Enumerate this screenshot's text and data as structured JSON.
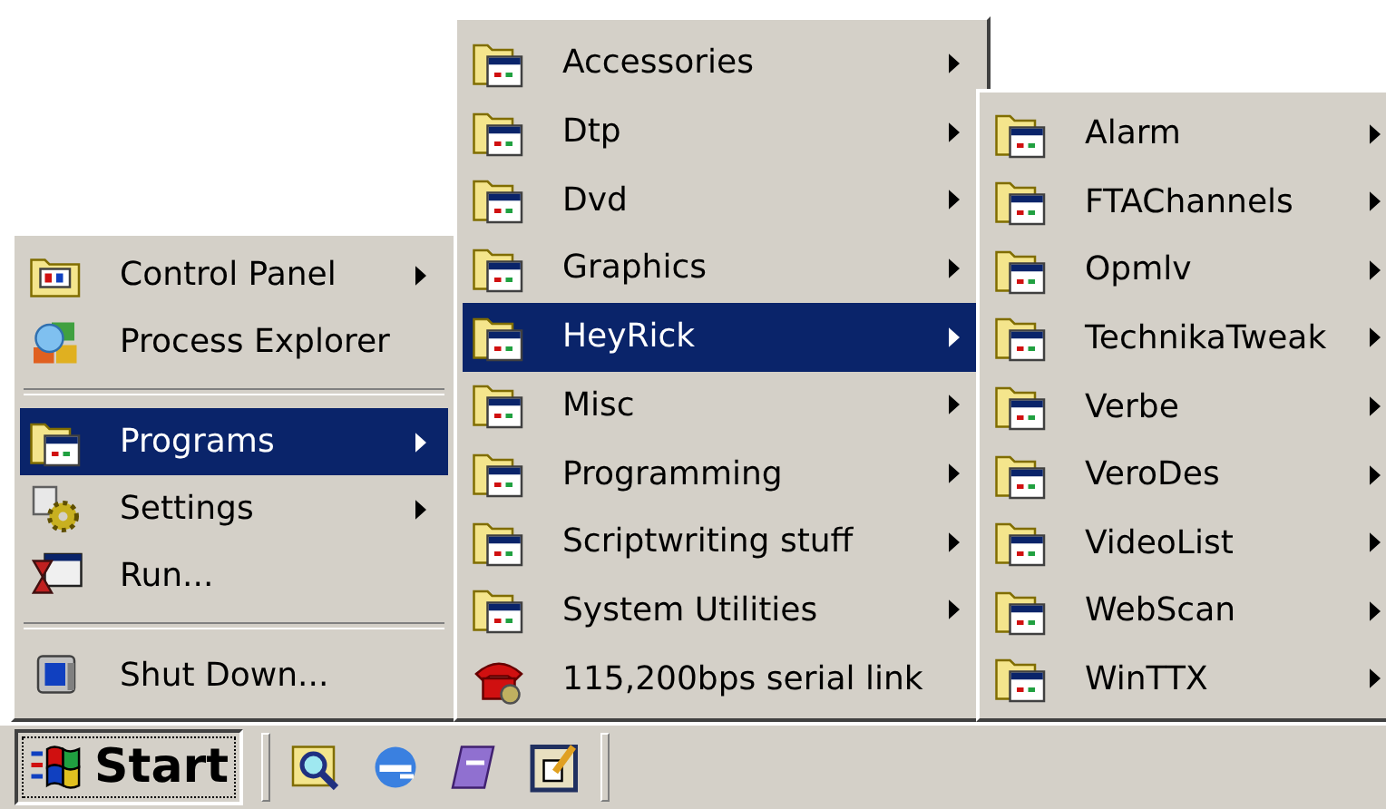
{
  "start_menu": {
    "items": [
      {
        "kind": "item",
        "label": "Control Panel",
        "submenu": true,
        "selected": false
      },
      {
        "kind": "item",
        "label": "Process Explorer",
        "submenu": false,
        "selected": false
      },
      {
        "kind": "separator"
      },
      {
        "kind": "item",
        "label": "Programs",
        "submenu": true,
        "selected": true
      },
      {
        "kind": "item",
        "label": "Settings",
        "submenu": true,
        "selected": false
      },
      {
        "kind": "item",
        "label": "Run...",
        "submenu": false,
        "selected": false
      },
      {
        "kind": "separator"
      },
      {
        "kind": "item",
        "label": "Shut Down...",
        "submenu": false,
        "selected": false
      }
    ]
  },
  "programs_menu": {
    "items": [
      {
        "kind": "folder",
        "label": "Accessories",
        "selected": false
      },
      {
        "kind": "folder",
        "label": "Dtp",
        "selected": false
      },
      {
        "kind": "folder",
        "label": "Dvd",
        "selected": false
      },
      {
        "kind": "folder",
        "label": "Graphics",
        "selected": false
      },
      {
        "kind": "folder",
        "label": "HeyRick",
        "selected": true
      },
      {
        "kind": "folder",
        "label": "Misc",
        "selected": false
      },
      {
        "kind": "folder",
        "label": "Programming",
        "selected": false
      },
      {
        "kind": "folder",
        "label": "Scriptwriting stuff",
        "selected": false
      },
      {
        "kind": "folder",
        "label": "System Utilities",
        "selected": false
      },
      {
        "kind": "shortcut",
        "label": "115,200bps serial link",
        "selected": false
      }
    ]
  },
  "heyrick_menu": {
    "items": [
      {
        "kind": "folder",
        "label": "Alarm",
        "selected": false
      },
      {
        "kind": "folder",
        "label": "FTAChannels",
        "selected": false
      },
      {
        "kind": "folder",
        "label": "Opmlv",
        "selected": false
      },
      {
        "kind": "folder",
        "label": "TechnikaTweak",
        "selected": false
      },
      {
        "kind": "folder",
        "label": "Verbe",
        "selected": false
      },
      {
        "kind": "folder",
        "label": "VeroDes",
        "selected": false
      },
      {
        "kind": "folder",
        "label": "VideoList",
        "selected": false
      },
      {
        "kind": "folder",
        "label": "WebScan",
        "selected": false
      },
      {
        "kind": "folder",
        "label": "WinTTX",
        "selected": false
      }
    ]
  },
  "taskbar": {
    "start_button": {
      "label": "Start"
    }
  }
}
